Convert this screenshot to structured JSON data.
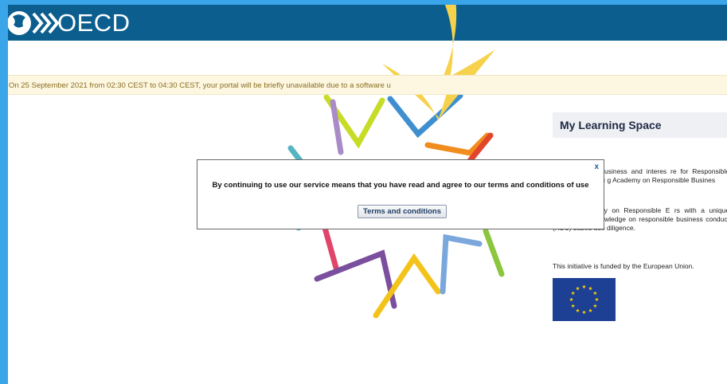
{
  "header": {
    "logo_text": "OECD"
  },
  "notice": {
    "text": "On 25 September 2021 from 02:30 CEST to 04:30 CEST, your portal will be briefly unavailable due to a software u"
  },
  "sidebar": {
    "title": "My Learning Space",
    "paragraph1": "ity-building for business and interes re for Responsible Business Conduc g Academy on Responsible Busines",
    "paragraph2": "earning Academy on Responsible E rs with a unique opportunity t knowledge on responsible business conduct (RBC) based due diligence.",
    "funded_text": "This initiative is funded by the European Union."
  },
  "modal": {
    "close_label": "x",
    "message": "By continuing to use our service means that you have read and agree to our terms and conditions of use",
    "button_label": "Terms and conditions"
  },
  "colors": {
    "outer_background": "#3aa5e8",
    "header": "#0b5e8e",
    "notice_background": "#fdf7e2",
    "eu_blue": "#1d3f94",
    "eu_gold": "#ffd200",
    "arrow_yellow": "#f6d24c"
  }
}
